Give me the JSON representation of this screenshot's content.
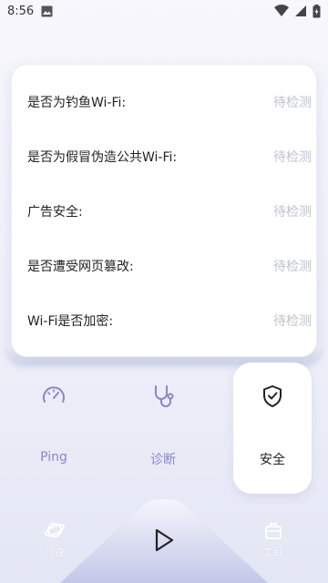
{
  "status": {
    "time": "8:56"
  },
  "checks": [
    {
      "label": "是否为钓鱼Wi-Fi:",
      "status": "待检测"
    },
    {
      "label": "是否为假冒伪造公共Wi-Fi:",
      "status": "待检测"
    },
    {
      "label": "广告安全:",
      "status": "待检测"
    },
    {
      "label": "是否遭受网页篡改:",
      "status": "待检测"
    },
    {
      "label": "Wi-Fi是否加密:",
      "status": "待检测"
    }
  ],
  "tabs": [
    {
      "label": "Ping",
      "icon": "speedometer-icon"
    },
    {
      "label": "诊断",
      "icon": "stethoscope-icon"
    },
    {
      "label": "安全",
      "icon": "shield-check-icon",
      "active": true
    }
  ],
  "bottom_nav": {
    "left": {
      "label": "测速",
      "icon": "planet-icon"
    },
    "center": {
      "icon": "play-icon"
    },
    "right": {
      "label": "工具",
      "icon": "toolbox-icon"
    }
  },
  "colors": {
    "accent": "#8a87c8",
    "pending": "#bfc2cc"
  }
}
